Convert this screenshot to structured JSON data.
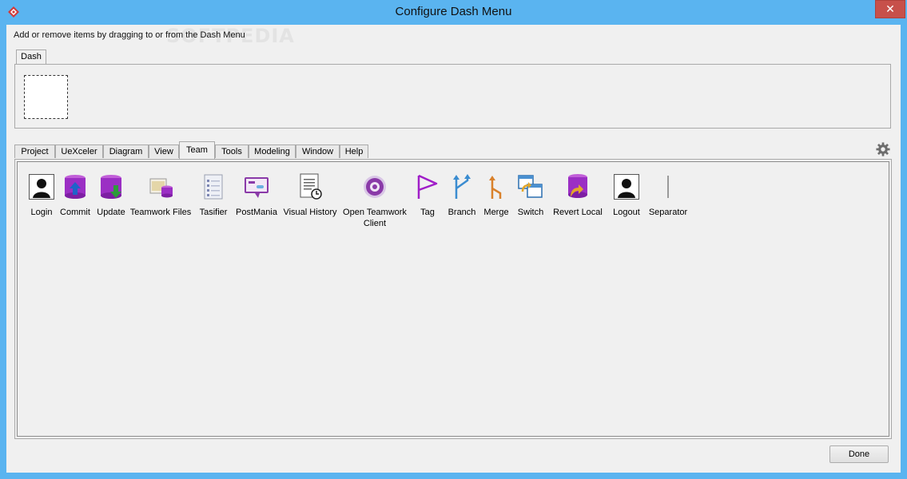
{
  "window": {
    "title": "Configure Dash Menu",
    "close_glyph": "✕"
  },
  "hint": "Add or remove items by dragging to or from the Dash Menu",
  "watermark": "SOFTPEDIA",
  "dash": {
    "tab_label": "Dash"
  },
  "tabs": [
    {
      "label": "Project"
    },
    {
      "label": "UeXceler"
    },
    {
      "label": "Diagram"
    },
    {
      "label": "View"
    },
    {
      "label": "Team",
      "active": true
    },
    {
      "label": "Tools"
    },
    {
      "label": "Modeling"
    },
    {
      "label": "Window"
    },
    {
      "label": "Help"
    }
  ],
  "items": [
    {
      "label": "Login",
      "icon": "user-silhouette-icon"
    },
    {
      "label": "Commit",
      "icon": "database-commit-icon"
    },
    {
      "label": "Update",
      "icon": "database-update-icon"
    },
    {
      "label": "Teamwork Files",
      "icon": "teamwork-files-icon"
    },
    {
      "label": "Tasifier",
      "icon": "task-list-icon"
    },
    {
      "label": "PostMania",
      "icon": "postmania-icon"
    },
    {
      "label": "Visual History",
      "icon": "visual-history-icon"
    },
    {
      "label": "Open Teamwork\nClient",
      "icon": "teamwork-client-icon"
    },
    {
      "label": "Tag",
      "icon": "tag-flag-icon"
    },
    {
      "label": "Branch",
      "icon": "branch-icon"
    },
    {
      "label": "Merge",
      "icon": "merge-icon"
    },
    {
      "label": "Switch",
      "icon": "switch-icon"
    },
    {
      "label": "Revert Local",
      "icon": "revert-local-icon"
    },
    {
      "label": "Logout",
      "icon": "user-silhouette-icon"
    },
    {
      "label": "Separator",
      "icon": "separator-icon"
    }
  ],
  "buttons": {
    "done": "Done"
  },
  "colors": {
    "titlebar": "#5ab4f0",
    "client": "#f0f0f0",
    "close": "#c7504a",
    "accent_purple": "#9b2fc4"
  }
}
